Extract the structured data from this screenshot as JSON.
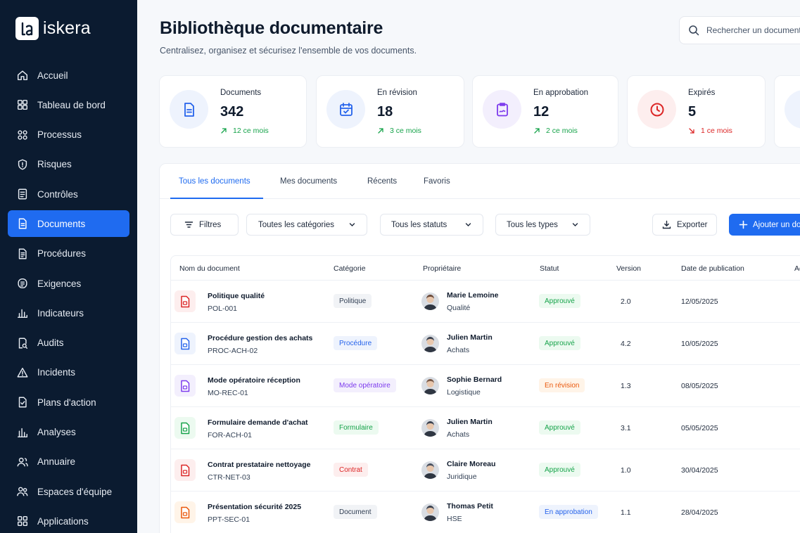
{
  "brand": {
    "name": "iskera"
  },
  "sidebar": {
    "items": [
      {
        "label": "Accueil",
        "icon": "home-icon"
      },
      {
        "label": "Tableau de bord",
        "icon": "dashboard-icon"
      },
      {
        "label": "Processus",
        "icon": "process-icon"
      },
      {
        "label": "Risques",
        "icon": "shield-icon"
      },
      {
        "label": "Contrôles",
        "icon": "checklist-icon"
      },
      {
        "label": "Documents",
        "icon": "document-icon",
        "active": true
      },
      {
        "label": "Procédures",
        "icon": "procedure-icon"
      },
      {
        "label": "Exigences",
        "icon": "requirement-icon"
      },
      {
        "label": "Indicateurs",
        "icon": "bar-chart-icon"
      },
      {
        "label": "Audits",
        "icon": "audit-icon"
      },
      {
        "label": "Incidents",
        "icon": "warning-icon"
      },
      {
        "label": "Plans d'action",
        "icon": "action-plan-icon"
      },
      {
        "label": "Analyses",
        "icon": "analytics-icon"
      },
      {
        "label": "Annuaire",
        "icon": "directory-icon"
      },
      {
        "label": "Espaces d'équipe",
        "icon": "team-icon"
      },
      {
        "label": "Applications",
        "icon": "apps-icon"
      }
    ]
  },
  "header": {
    "title": "Bibliothèque documentaire",
    "subtitle": "Centralisez, organisez et sécurisez l'ensemble de vos documents.",
    "search_placeholder": "Rechercher un document"
  },
  "stats": [
    {
      "label": "Documents",
      "value": "342",
      "delta": "12 ce mois",
      "trend": "up",
      "color": "#2563eb",
      "bg": "#eef3fd"
    },
    {
      "label": "En révision",
      "value": "18",
      "delta": "3 ce mois",
      "trend": "up",
      "color": "#2563eb",
      "bg": "#eef3fd"
    },
    {
      "label": "En approbation",
      "value": "12",
      "delta": "2 ce mois",
      "trend": "up",
      "color": "#7c3aed",
      "bg": "#f3effd"
    },
    {
      "label": "Expirés",
      "value": "5",
      "delta": "1 ce mois",
      "trend": "down",
      "color": "#dc2626",
      "bg": "#fdeeee"
    }
  ],
  "tabs": [
    {
      "label": "Tous les documents",
      "active": true
    },
    {
      "label": "Mes documents"
    },
    {
      "label": "Récents"
    },
    {
      "label": "Favoris"
    }
  ],
  "filters": {
    "filters_label": "Filtres",
    "category": "Toutes les catégories",
    "status": "Tous les statuts",
    "type": "Tous les types",
    "export_label": "Exporter",
    "add_label": "Ajouter un document"
  },
  "table": {
    "columns": [
      "Nom du document",
      "Catégorie",
      "Propriétaire",
      "Statut",
      "Version",
      "Date de publication",
      "Actions"
    ],
    "rows": [
      {
        "name": "Politique qualité",
        "code": "POL-001",
        "icon_color": "#dc2626",
        "icon_bg": "#fdeeee",
        "category": "Politique",
        "cat_color": "#334155",
        "cat_bg": "#f1f3f6",
        "owner": "Marie Lemoine",
        "dept": "Qualité",
        "status": "Approuvé",
        "status_color": "#16a34a",
        "status_bg": "#ecfaf0",
        "version": "2.0",
        "date": "12/05/2025"
      },
      {
        "name": "Procédure gestion des achats",
        "code": "PROC-ACH-02",
        "icon_color": "#2563eb",
        "icon_bg": "#eef3fd",
        "category": "Procédure",
        "cat_color": "#2563eb",
        "cat_bg": "#eef3fd",
        "owner": "Julien Martin",
        "dept": "Achats",
        "status": "Approuvé",
        "status_color": "#16a34a",
        "status_bg": "#ecfaf0",
        "version": "4.2",
        "date": "10/05/2025"
      },
      {
        "name": "Mode opératoire réception",
        "code": "MO-REC-01",
        "icon_color": "#7c3aed",
        "icon_bg": "#f3effd",
        "category": "Mode opératoire",
        "cat_color": "#7c3aed",
        "cat_bg": "#f3effd",
        "owner": "Sophie Bernard",
        "dept": "Logistique",
        "status": "En révision",
        "status_color": "#ea580c",
        "status_bg": "#fff4e8",
        "version": "1.3",
        "date": "08/05/2025"
      },
      {
        "name": "Formulaire demande d'achat",
        "code": "FOR-ACH-01",
        "icon_color": "#16a34a",
        "icon_bg": "#ecfaf0",
        "category": "Formulaire",
        "cat_color": "#16a34a",
        "cat_bg": "#ecfaf0",
        "owner": "Julien Martin",
        "dept": "Achats",
        "status": "Approuvé",
        "status_color": "#16a34a",
        "status_bg": "#ecfaf0",
        "version": "3.1",
        "date": "05/05/2025"
      },
      {
        "name": "Contrat prestataire nettoyage",
        "code": "CTR-NET-03",
        "icon_color": "#dc2626",
        "icon_bg": "#fdeeee",
        "category": "Contrat",
        "cat_color": "#dc2626",
        "cat_bg": "#fdeeee",
        "owner": "Claire Moreau",
        "dept": "Juridique",
        "status": "Approuvé",
        "status_color": "#16a34a",
        "status_bg": "#ecfaf0",
        "version": "1.0",
        "date": "30/04/2025"
      },
      {
        "name": "Présentation sécurité 2025",
        "code": "PPT-SEC-01",
        "icon_color": "#ea580c",
        "icon_bg": "#fff4e8",
        "category": "Document",
        "cat_color": "#334155",
        "cat_bg": "#f1f3f6",
        "owner": "Thomas Petit",
        "dept": "HSE",
        "status": "En approbation",
        "status_color": "#2563eb",
        "status_bg": "#eef3fd",
        "version": "1.1",
        "date": "28/04/2025"
      }
    ]
  },
  "colors": {
    "sidebar_bg": "#0b1b30",
    "accent": "#1f6bf0"
  }
}
